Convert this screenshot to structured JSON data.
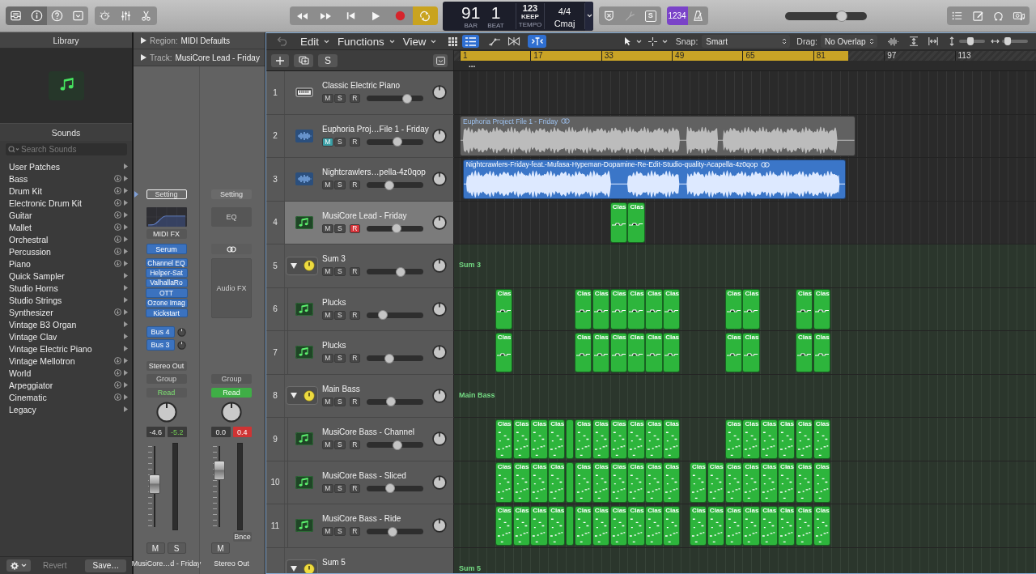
{
  "toolbar": {
    "view_buttons": [
      {
        "kind": "library",
        "on": true
      },
      {
        "kind": "inspector",
        "on": true
      },
      {
        "kind": "help",
        "on": false
      },
      {
        "kind": "toolbar",
        "on": false
      }
    ],
    "window_buttons": [
      {
        "kind": "smart-controls",
        "on": false
      },
      {
        "kind": "mixer",
        "on": false
      },
      {
        "kind": "editors",
        "on": false
      }
    ],
    "transport": [
      {
        "kind": "rewind",
        "on": false
      },
      {
        "kind": "forward",
        "on": false
      },
      {
        "kind": "to-start",
        "on": false
      },
      {
        "kind": "play",
        "on": false
      },
      {
        "kind": "record",
        "on": false
      },
      {
        "kind": "cycle",
        "on": true
      }
    ],
    "lcd": {
      "bar": "91",
      "bar_label": "BAR",
      "beat": "1",
      "beat_label": "BEAT",
      "tempo": "123",
      "tempo_mode": "KEEP",
      "tempo_label": "TEMPO",
      "signature": "4/4",
      "key": "Cmaj"
    },
    "modes": [
      {
        "kind": "replace",
        "disabled": false
      },
      {
        "kind": "tuner",
        "disabled": true
      },
      {
        "kind": "solo",
        "label": "S",
        "disabled": false
      }
    ],
    "count_in": {
      "label": "1234",
      "on": true
    },
    "metronome": {
      "on": false
    },
    "master_volume": {
      "level": 0.72
    },
    "panels": [
      {
        "kind": "list-editors",
        "on": false
      },
      {
        "kind": "note-pad",
        "on": false
      },
      {
        "kind": "loops",
        "on": false
      },
      {
        "kind": "browser",
        "on": false
      }
    ]
  },
  "library": {
    "title": "Library",
    "section": "Sounds",
    "search": {
      "placeholder": "Search Sounds"
    },
    "categories": [
      {
        "label": "User Patches",
        "downloadable": false
      },
      {
        "label": "Bass",
        "downloadable": true
      },
      {
        "label": "Drum Kit",
        "downloadable": true
      },
      {
        "label": "Electronic Drum Kit",
        "downloadable": true
      },
      {
        "label": "Guitar",
        "downloadable": true
      },
      {
        "label": "Mallet",
        "downloadable": true
      },
      {
        "label": "Orchestral",
        "downloadable": true
      },
      {
        "label": "Percussion",
        "downloadable": true
      },
      {
        "label": "Piano",
        "downloadable": true
      },
      {
        "label": "Quick Sampler",
        "downloadable": false
      },
      {
        "label": "Studio Horns",
        "downloadable": false
      },
      {
        "label": "Studio Strings",
        "downloadable": false
      },
      {
        "label": "Synthesizer",
        "downloadable": true
      },
      {
        "label": "Vintage B3 Organ",
        "downloadable": false
      },
      {
        "label": "Vintage Clav",
        "downloadable": false
      },
      {
        "label": "Vintage Electric Piano",
        "downloadable": false
      },
      {
        "label": "Vintage Mellotron",
        "downloadable": true
      },
      {
        "label": "World",
        "downloadable": true
      },
      {
        "label": "Arpeggiator",
        "downloadable": true
      },
      {
        "label": "Cinematic",
        "downloadable": true
      },
      {
        "label": "Legacy",
        "downloadable": false
      }
    ],
    "footer": {
      "revert": {
        "label": "Revert",
        "disabled": true
      },
      "save": {
        "label": "Save…",
        "disabled": false
      }
    }
  },
  "inspector": {
    "region": {
      "label": "Region:",
      "value": "MIDI Defaults",
      "expanded": false
    },
    "track": {
      "label": "Track:",
      "value": "MusiCore Lead - Friday",
      "expanded": false
    },
    "strips": [
      {
        "setting": {
          "label": "Setting",
          "selected": true
        },
        "eq": {
          "kind": "graph"
        },
        "midi_fx": "MIDI FX",
        "instrument": {
          "kind": "plugin",
          "label": "Serum"
        },
        "plugins": [
          "Channel EQ",
          "Helper-Sat",
          "ValhallaRo",
          "OTT",
          "Ozone Imag",
          "Kickstart"
        ],
        "sends": [
          "Bus 4",
          "Bus 3"
        ],
        "output": "Stereo Out",
        "group": "Group",
        "automation": {
          "label": "Read",
          "selected": false
        },
        "volume": "-4.6",
        "peak": {
          "value": "-5.2",
          "clipping": false
        },
        "fader": {
          "level": 0.54
        },
        "buttons": [
          {
            "label": "M",
            "on": false
          },
          {
            "label": "S",
            "on": false
          }
        ],
        "name": "MusiCore…d - Friday"
      },
      {
        "setting": {
          "label": "Setting",
          "selected": false
        },
        "eq": {
          "kind": "label",
          "label": "EQ"
        },
        "instrument": {
          "kind": "link"
        },
        "audio_fx": "Audio FX",
        "group": "Group",
        "automation": {
          "label": "Read",
          "selected": true
        },
        "volume": "0.0",
        "peak": {
          "value": "0.4",
          "clipping": true
        },
        "fader": {
          "level": 0.74
        },
        "bounce": "Bnce",
        "buttons": [
          {
            "label": "M",
            "on": false
          }
        ],
        "name": "Stereo Out"
      }
    ]
  },
  "arrange": {
    "menus": [
      "Edit",
      "Functions",
      "View"
    ],
    "view_modes": [
      {
        "kind": "grid",
        "selected": false
      },
      {
        "kind": "list",
        "selected": true
      }
    ],
    "tools": [
      {
        "kind": "automation",
        "on": false
      },
      {
        "kind": "flex",
        "on": false
      },
      {
        "kind": "catch",
        "on": true
      }
    ],
    "snap": {
      "label": "Snap:",
      "value": "Smart"
    },
    "drag": {
      "label": "Drag:",
      "value": "No Overlap"
    },
    "zoom_vertical": {
      "level": 0.42
    },
    "zoom_horizontal": {
      "level": 0.12
    },
    "global_solo": "S",
    "ruler": {
      "marks": [
        "1",
        "17",
        "33",
        "49",
        "65",
        "81",
        "97",
        "113"
      ],
      "marker": "..."
    },
    "tracks": [
      {
        "number": "1",
        "name": "Classic Electric Piano",
        "kind": "keyboard",
        "selected": false,
        "buttons": [
          {
            "kind": "mute",
            "label": "M",
            "on": false
          },
          {
            "kind": "solo",
            "label": "S",
            "on": false
          },
          {
            "kind": "record",
            "label": "R",
            "on": false
          }
        ],
        "level": 0.75
      },
      {
        "number": "2",
        "name": "Euphoria Proj…File 1 - Friday",
        "kind": "audio",
        "selected": false,
        "buttons": [
          {
            "kind": "mute",
            "label": "M",
            "on": true
          },
          {
            "kind": "solo",
            "label": "S",
            "on": false
          },
          {
            "kind": "record",
            "label": "R",
            "on": false
          }
        ],
        "level": 0.56,
        "regions": [
          {
            "kind": "audio",
            "name": "Euphoria Project File 1 - Friday"
          }
        ]
      },
      {
        "number": "3",
        "name": "Nightcrawlers…pella-4z0qop",
        "kind": "audio",
        "selected": false,
        "color": "#3b76c8",
        "buttons": [
          {
            "kind": "mute",
            "label": "M",
            "on": false
          },
          {
            "kind": "solo",
            "label": "S",
            "on": false
          },
          {
            "kind": "record",
            "label": "R",
            "on": false
          }
        ],
        "level": 0.38,
        "regions": [
          {
            "kind": "audio",
            "name": "Nightcrawlers-Friday-feat.-Mufasa-Hypeman-Dopamine-Re-Edit-Studio-quality-Acapella-4z0qop"
          }
        ]
      },
      {
        "number": "4",
        "name": "MusiCore Lead - Friday",
        "kind": "midi",
        "selected": true,
        "color": "#2db53c",
        "buttons": [
          {
            "kind": "mute",
            "label": "M",
            "on": false
          },
          {
            "kind": "solo",
            "label": "S",
            "on": false
          },
          {
            "kind": "record",
            "label": "R",
            "on": true
          }
        ],
        "level": 0.54,
        "regions": [
          {
            "kind": "sustained",
            "name": "Clas"
          },
          {
            "kind": "sustained",
            "name": "Clas"
          }
        ]
      },
      {
        "number": "5",
        "name": "Sum 3",
        "kind": "folder",
        "selected": false,
        "expanded": true,
        "lane_label": "Sum 3",
        "buttons": [
          {
            "kind": "mute",
            "label": "M",
            "on": false
          },
          {
            "kind": "solo",
            "label": "S",
            "on": false
          },
          {
            "kind": "record",
            "label": "R",
            "on": false
          }
        ],
        "level": 0.62,
        "children": [
          {
            "number": "6",
            "name": "Plucks",
            "kind": "midi",
            "selected": false,
            "color": "#2db53c",
            "buttons": [
              {
                "kind": "mute",
                "label": "M",
                "on": false
              },
              {
                "kind": "solo",
                "label": "S",
                "on": false
              },
              {
                "kind": "record",
                "label": "R",
                "on": false
              }
            ],
            "level": 0.24,
            "regions": [
              {
                "kind": "sustained",
                "name": "Clas"
              },
              {
                "kind": "sustained",
                "name": "Clas"
              },
              {
                "kind": "sustained",
                "name": "Clas"
              },
              {
                "kind": "sustained",
                "name": "Clas"
              },
              {
                "kind": "sustained",
                "name": "Clas"
              },
              {
                "kind": "sustained",
                "name": "Clas"
              },
              {
                "kind": "sustained",
                "name": "Clas"
              },
              {
                "kind": "sustained",
                "name": "Clas"
              },
              {
                "kind": "sustained",
                "name": "Clas"
              },
              {
                "kind": "sustained",
                "name": "Clas"
              },
              {
                "kind": "sustained",
                "name": "Clas"
              }
            ]
          },
          {
            "number": "7",
            "name": "Plucks",
            "kind": "midi",
            "selected": false,
            "color": "#2db53c",
            "buttons": [
              {
                "kind": "mute",
                "label": "M",
                "on": false
              },
              {
                "kind": "solo",
                "label": "S",
                "on": false
              },
              {
                "kind": "record",
                "label": "R",
                "on": false
              }
            ],
            "level": 0.38,
            "regions": [
              {
                "kind": "sustained",
                "name": "Clas"
              },
              {
                "kind": "sustained",
                "name": "Clas"
              },
              {
                "kind": "sustained",
                "name": "Clas"
              },
              {
                "kind": "sustained",
                "name": "Clas"
              },
              {
                "kind": "sustained",
                "name": "Clas"
              },
              {
                "kind": "sustained",
                "name": "Clas"
              },
              {
                "kind": "sustained",
                "name": "Clas"
              },
              {
                "kind": "sustained",
                "name": "Clas"
              },
              {
                "kind": "sustained",
                "name": "Clas"
              },
              {
                "kind": "sustained",
                "name": "Clas"
              },
              {
                "kind": "sustained",
                "name": "Clas"
              }
            ]
          }
        ]
      },
      {
        "number": "8",
        "name": "Main Bass",
        "kind": "folder",
        "selected": false,
        "expanded": true,
        "lane_label": "Main Bass",
        "buttons": [
          {
            "kind": "mute",
            "label": "M",
            "on": false
          },
          {
            "kind": "solo",
            "label": "S",
            "on": false
          },
          {
            "kind": "record",
            "label": "R",
            "on": false
          }
        ],
        "level": 0.42,
        "children": [
          {
            "number": "9",
            "name": "MusiCore Bass - Channel",
            "kind": "midi",
            "selected": false,
            "color": "#2db53c",
            "buttons": [
              {
                "kind": "mute",
                "label": "M",
                "on": false
              },
              {
                "kind": "solo",
                "label": "S",
                "on": false
              },
              {
                "kind": "record",
                "label": "R",
                "on": false
              }
            ],
            "level": 0.56,
            "regions": [
              {
                "kind": "short",
                "name": "Clas"
              },
              {
                "kind": "short",
                "name": "Clas"
              },
              {
                "kind": "short",
                "name": "Clas"
              },
              {
                "kind": "short",
                "name": "Clas"
              },
              {
                "kind": "short"
              },
              {
                "kind": "short",
                "name": "Clas"
              },
              {
                "kind": "short",
                "name": "Clas"
              },
              {
                "kind": "short",
                "name": "Clas"
              },
              {
                "kind": "short",
                "name": "Clas"
              },
              {
                "kind": "short",
                "name": "Clas"
              },
              {
                "kind": "short",
                "name": "Clas"
              },
              {
                "kind": "short",
                "name": "Clas"
              },
              {
                "kind": "short",
                "name": "Clas"
              },
              {
                "kind": "short",
                "name": "Clas"
              },
              {
                "kind": "short",
                "name": "Clas"
              },
              {
                "kind": "short",
                "name": "Clas"
              },
              {
                "kind": "short",
                "name": "Clas"
              }
            ]
          },
          {
            "number": "10",
            "name": "MusiCore Bass - Sliced",
            "kind": "midi",
            "selected": false,
            "color": "#2db53c",
            "buttons": [
              {
                "kind": "mute",
                "label": "M",
                "on": false
              },
              {
                "kind": "solo",
                "label": "S",
                "on": false
              },
              {
                "kind": "record",
                "label": "R",
                "on": false
              }
            ],
            "level": 0.4,
            "regions": [
              {
                "kind": "short",
                "name": "Clas"
              },
              {
                "kind": "short",
                "name": "Clas"
              },
              {
                "kind": "short",
                "name": "Clas"
              },
              {
                "kind": "short",
                "name": "Clas"
              },
              {
                "kind": "short"
              },
              {
                "kind": "short",
                "name": "Clas"
              },
              {
                "kind": "short",
                "name": "Clas"
              },
              {
                "kind": "short",
                "name": "Clas"
              },
              {
                "kind": "short",
                "name": "Clas"
              },
              {
                "kind": "short",
                "name": "Clas"
              },
              {
                "kind": "short",
                "name": "Clas"
              },
              {
                "kind": "short",
                "name": "Clas"
              },
              {
                "kind": "short",
                "name": "Clas"
              },
              {
                "kind": "short",
                "name": "Clas"
              },
              {
                "kind": "short",
                "name": "Clas"
              },
              {
                "kind": "short",
                "name": "Clas"
              },
              {
                "kind": "short",
                "name": "Clas"
              },
              {
                "kind": "short",
                "name": "Clas"
              },
              {
                "kind": "short",
                "name": "Clas"
              }
            ]
          },
          {
            "number": "11",
            "name": "MusiCore Bass - Ride",
            "kind": "midi",
            "selected": false,
            "color": "#2db53c",
            "buttons": [
              {
                "kind": "mute",
                "label": "M",
                "on": false
              },
              {
                "kind": "solo",
                "label": "S",
                "on": false
              },
              {
                "kind": "record",
                "label": "R",
                "on": false
              }
            ],
            "level": 0.45,
            "regions": [
              {
                "kind": "short",
                "name": "Clas"
              },
              {
                "kind": "short",
                "name": "Clas"
              },
              {
                "kind": "short",
                "name": "Clas"
              },
              {
                "kind": "short",
                "name": "Clas"
              },
              {
                "kind": "short"
              },
              {
                "kind": "short",
                "name": "Clas"
              },
              {
                "kind": "short",
                "name": "Clas"
              },
              {
                "kind": "short",
                "name": "Clas"
              },
              {
                "kind": "short",
                "name": "Clas"
              },
              {
                "kind": "short",
                "name": "Clas"
              },
              {
                "kind": "short",
                "name": "Clas"
              },
              {
                "kind": "short",
                "name": "Clas"
              },
              {
                "kind": "short",
                "name": "Clas"
              },
              {
                "kind": "short",
                "name": "Clas"
              },
              {
                "kind": "short",
                "name": "Clas"
              },
              {
                "kind": "short",
                "name": "Clas"
              },
              {
                "kind": "short",
                "name": "Clas"
              },
              {
                "kind": "short",
                "name": "Clas"
              },
              {
                "kind": "short",
                "name": "Clas"
              }
            ]
          }
        ]
      },
      {
        "name": "Sum 5",
        "kind": "folder",
        "selected": false,
        "expanded": true,
        "lane_label": "Sum 5"
      }
    ]
  }
}
